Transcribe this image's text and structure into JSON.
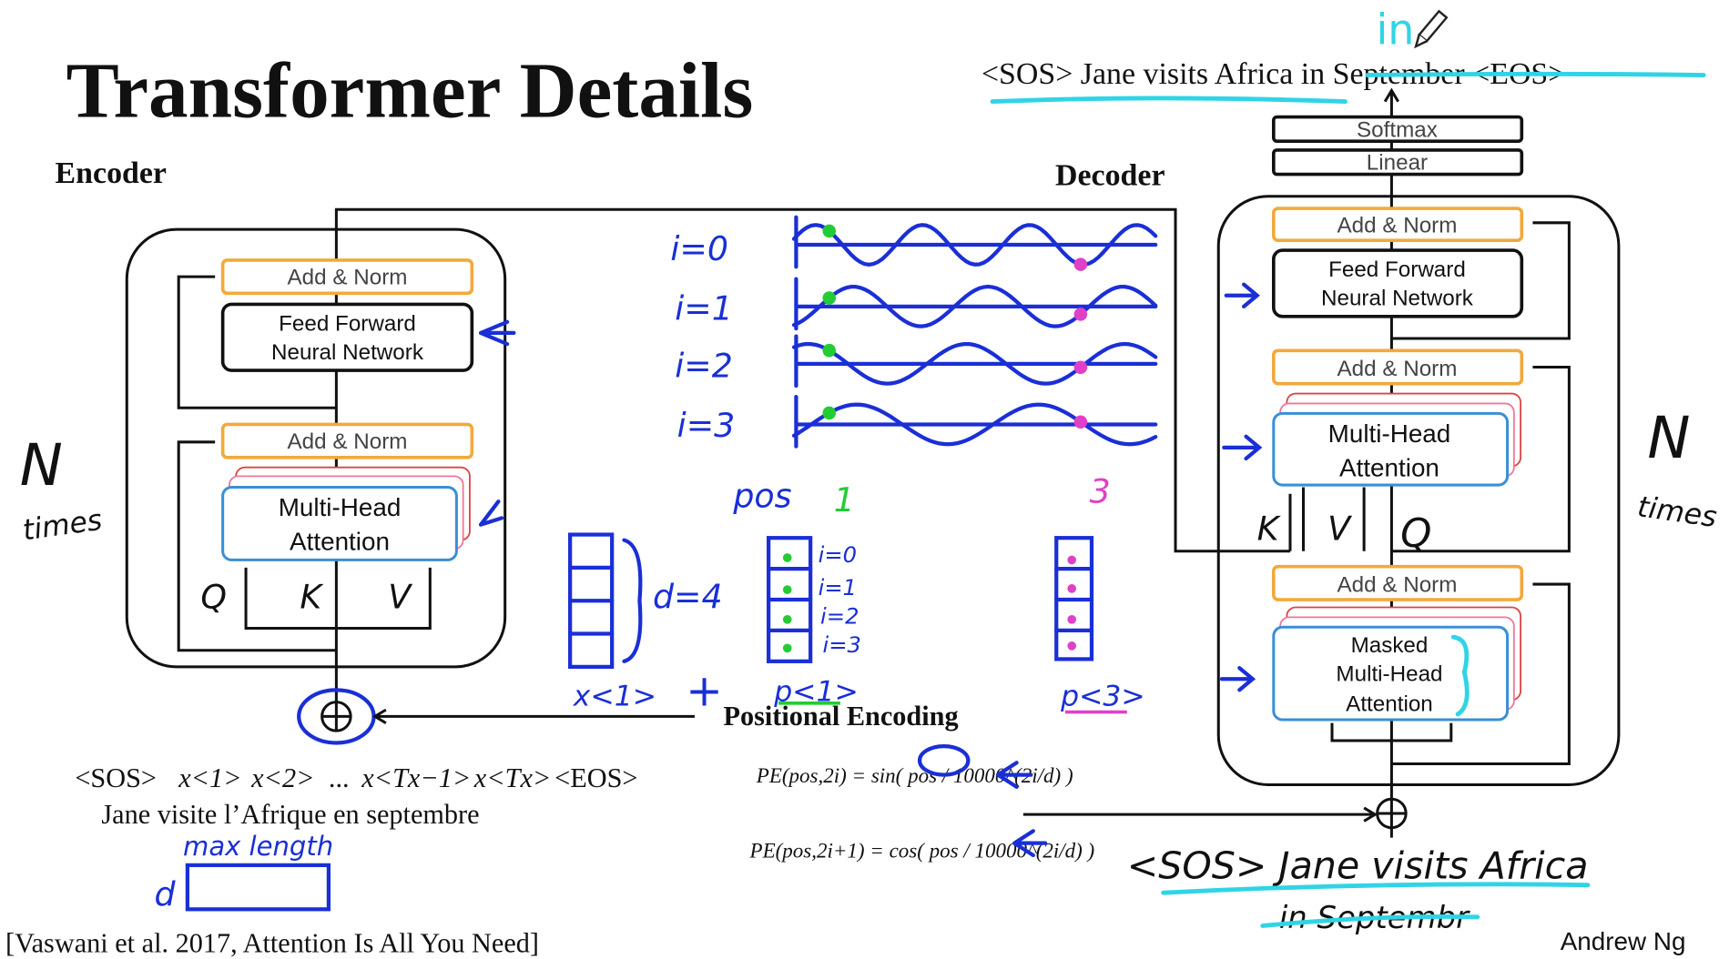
{
  "title": "Transformer Details",
  "encoder": {
    "heading": "Encoder",
    "add_norm": "Add & Norm",
    "ffn_line1": "Feed Forward",
    "ffn_line2": "Neural Network",
    "mha_line1": "Multi-Head",
    "mha_line2": "Attention",
    "q": "Q",
    "k": "K",
    "v": "V",
    "n": "N",
    "times": "times",
    "input_tokens": [
      "<SOS>",
      "x<1>",
      "x<2>",
      "...",
      "x<Tx−1>",
      "x<Tx>",
      "<EOS>"
    ],
    "input_sentence": "Jane visite l’Afrique en septembre",
    "max_length": "max length",
    "d": "d"
  },
  "decoder": {
    "heading": "Decoder",
    "softmax": "Softmax",
    "linear": "Linear",
    "add_norm": "Add & Norm",
    "ffn_line1": "Feed Forward",
    "ffn_line2": "Neural Network",
    "mha_line1": "Multi-Head",
    "mha_line2": "Attention",
    "masked_line1": "Masked",
    "masked_line2": "Multi-Head",
    "masked_line3": "Attention",
    "k": "K",
    "v": "V",
    "q": "Q",
    "n": "N",
    "times": "times",
    "output_sentence": "<SOS> Jane visits Africa in September <EOS>",
    "handwritten_in": "in",
    "handwritten_input": "<SOS> Jane visits Africa",
    "handwritten_crossed": "in Septembr"
  },
  "positional_encoding": {
    "heading": "Positional Encoding",
    "wave_labels": [
      "i=0",
      "i=1",
      "i=2",
      "i=3"
    ],
    "pos_label": "pos",
    "pos_values": [
      "1",
      "3"
    ],
    "d_label": "d=4",
    "x1_label": "x<1>",
    "plus": "+",
    "p1_label": "p<1>",
    "p3_label": "p<3>",
    "p1_rows": [
      "i=0",
      "i=1",
      "i=2",
      "i=3"
    ],
    "formula_sin": "PE(pos,2i) = sin( pos / 10000^(2i/d) )",
    "formula_cos": "PE(pos,2i+1) = cos( pos / 10000^(2i/d) )",
    "colors": {
      "ink": "#1a2fd6",
      "pos1": "#22cc33",
      "pos3": "#e040c8",
      "highlight": "#2fd4e6"
    }
  },
  "citation": "[Vaswani et al. 2017, Attention Is All You Need]",
  "author": "Andrew Ng",
  "icons": [
    "pencil-icon",
    "add-circle-icon",
    "arrow-left-icon"
  ]
}
